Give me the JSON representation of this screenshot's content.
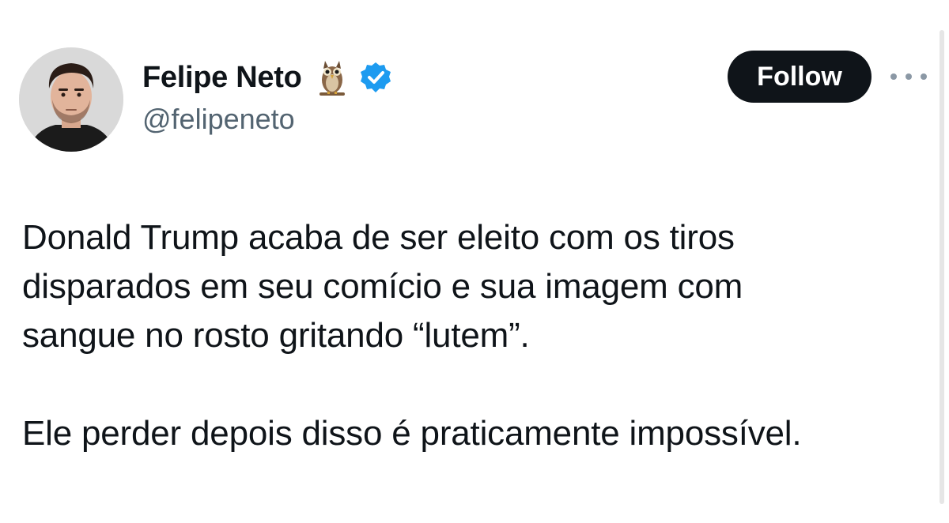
{
  "tweet": {
    "author": {
      "display_name": "Felipe Neto",
      "handle": "@felipeneto",
      "emoji_icon": "owl-icon",
      "verified_icon": "verified-badge-icon",
      "verified_color": "#1d9bf0"
    },
    "actions": {
      "follow_label": "Follow",
      "more_icon": "more-dots-icon"
    },
    "text": {
      "paragraph_1": "Donald Trump acaba de ser eleito com os tiros\ndisparados em seu comício e sua imagem com\nsangue no rosto gritando “lutem”.",
      "paragraph_2": "Ele perder depois disso é praticamente impossível."
    }
  },
  "colors": {
    "text_primary": "#0f1419",
    "text_secondary": "#536471",
    "follow_bg": "#0f1419",
    "follow_text": "#ffffff"
  }
}
